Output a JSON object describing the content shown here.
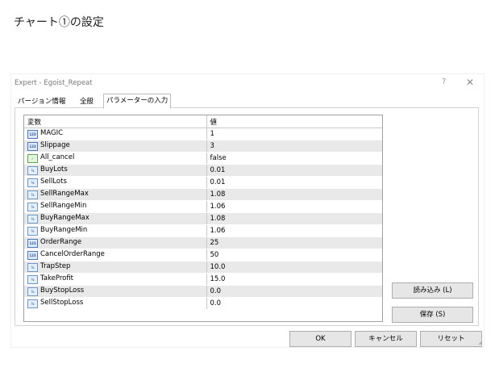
{
  "page": {
    "heading": "チャート①の設定"
  },
  "dialog": {
    "title": "Expert - Egoist_Repeat",
    "help": "?",
    "close": "✕"
  },
  "tabs": [
    {
      "label": "パージョン情報",
      "active": false
    },
    {
      "label": "全般",
      "active": false
    },
    {
      "label": "パラメーターの入力",
      "active": true
    }
  ],
  "table": {
    "headers": [
      "変数",
      "値"
    ],
    "rows": [
      {
        "icon": "int-icon",
        "glyph": "123",
        "name": "MAGIC",
        "value": "1"
      },
      {
        "icon": "int-icon",
        "glyph": "123",
        "name": "Slippage",
        "value": "3"
      },
      {
        "icon": "bool-icon",
        "glyph": "✓",
        "name": "All_cancel",
        "value": "false"
      },
      {
        "icon": "double-icon",
        "glyph": "½",
        "name": "BuyLots",
        "value": "0.01"
      },
      {
        "icon": "double-icon",
        "glyph": "½",
        "name": "SellLots",
        "value": "0.01"
      },
      {
        "icon": "double-icon",
        "glyph": "½",
        "name": "SellRangeMax",
        "value": "1.08"
      },
      {
        "icon": "double-icon",
        "glyph": "½",
        "name": "SellRangeMin",
        "value": "1.06"
      },
      {
        "icon": "double-icon",
        "glyph": "½",
        "name": "BuyRangeMax",
        "value": "1.08"
      },
      {
        "icon": "double-icon",
        "glyph": "½",
        "name": "BuyRangeMin",
        "value": "1.06"
      },
      {
        "icon": "int-icon",
        "glyph": "123",
        "name": "OrderRange",
        "value": "25"
      },
      {
        "icon": "int-icon",
        "glyph": "123",
        "name": "CancelOrderRange",
        "value": "50"
      },
      {
        "icon": "double-icon",
        "glyph": "½",
        "name": "TrapStep",
        "value": "10.0"
      },
      {
        "icon": "double-icon",
        "glyph": "½",
        "name": "TakeProfit",
        "value": "15.0"
      },
      {
        "icon": "double-icon",
        "glyph": "½",
        "name": "BuyStopLoss",
        "value": "0.0"
      },
      {
        "icon": "double-icon",
        "glyph": "½",
        "name": "SellStopLoss",
        "value": "0.0"
      }
    ]
  },
  "buttons": {
    "load": "読み込み (L)",
    "save": "保存 (S)",
    "ok": "OK",
    "cancel": "キャンセル",
    "reset": "リセット"
  }
}
